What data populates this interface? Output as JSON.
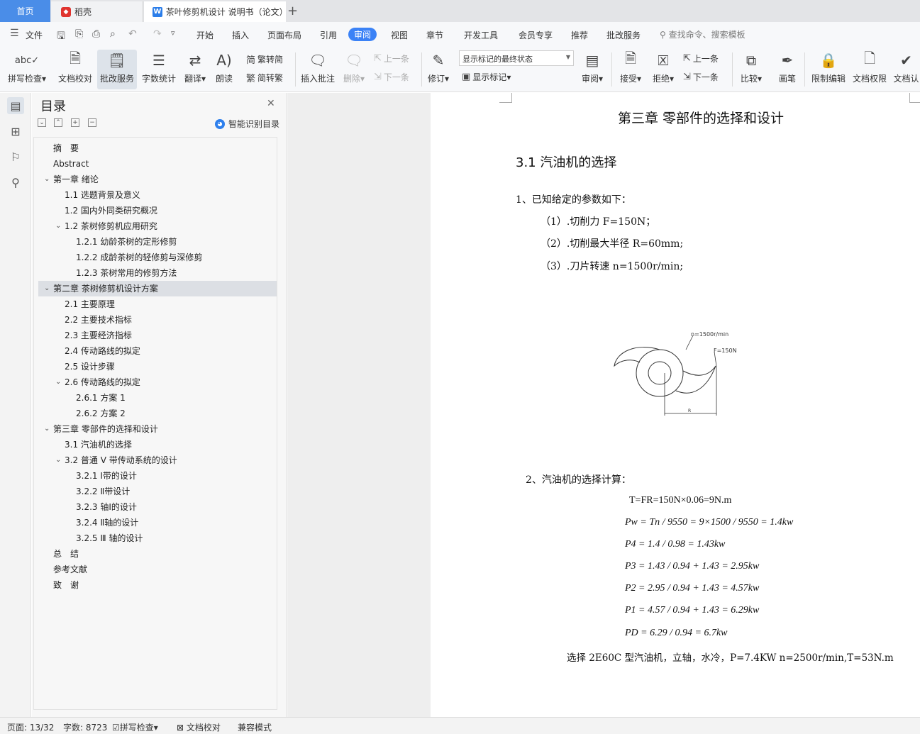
{
  "tabs": {
    "home": "首页",
    "daoke": "稻壳",
    "doc": "茶叶修剪机设计 说明书（论文）",
    "add": "+"
  },
  "menu": {
    "file": "文件",
    "items": [
      "开始",
      "插入",
      "页面布局",
      "引用",
      "审阅",
      "视图",
      "章节",
      "开发工具",
      "会员专享",
      "推荐",
      "批改服务"
    ],
    "active": "审阅",
    "search_placeholder": "查找命令、搜索模板"
  },
  "ribbon": {
    "spell": "拼写检查",
    "doc_check": "文档校对",
    "review_service": "批改服务",
    "word_count": "字数统计",
    "translate": "翻译",
    "read_aloud": "朗读",
    "trad": "繁转简",
    "simp": "简转繁",
    "insert_comment": "插入批注",
    "delete": "删除",
    "prev": "上一条",
    "next": "下一条",
    "revise": "修订",
    "markup_state": "显示标记的最终状态",
    "show_markup": "显示标记",
    "review": "审阅",
    "accept": "接受",
    "reject": "拒绝",
    "prev2": "上一条",
    "next2": "下一条",
    "compare": "比较",
    "pen": "画笔",
    "restrict": "限制编辑",
    "permission": "文档权限",
    "certify": "文档认"
  },
  "toc": {
    "title": "目录",
    "smart": "智能识别目录",
    "items": [
      {
        "text": "摘　要",
        "level": 1,
        "caret": ""
      },
      {
        "text": "Abstract",
        "level": 1,
        "caret": ""
      },
      {
        "text": "第一章  绪论",
        "level": 1,
        "caret": "v"
      },
      {
        "text": "1.1 选题背景及意义",
        "level": 2,
        "caret": ""
      },
      {
        "text": "1.2 国内外同类研究概况",
        "level": 2,
        "caret": ""
      },
      {
        "text": "1.2 茶树修剪机应用研究",
        "level": 2,
        "caret": "v"
      },
      {
        "text": "1.2.1 幼龄茶树的定形修剪",
        "level": 3,
        "caret": ""
      },
      {
        "text": "1.2.2 成龄茶树的轻修剪与深修剪",
        "level": 3,
        "caret": ""
      },
      {
        "text": "1.2.3 茶树常用的修剪方法",
        "level": 3,
        "caret": ""
      },
      {
        "text": "第二章  茶树修剪机设计方案",
        "level": 1,
        "caret": "v",
        "selected": true
      },
      {
        "text": "2.1 主要原理",
        "level": 2,
        "caret": ""
      },
      {
        "text": "2.2 主要技术指标",
        "level": 2,
        "caret": ""
      },
      {
        "text": "2.3 主要经济指标",
        "level": 2,
        "caret": ""
      },
      {
        "text": "2.4 传动路线的拟定",
        "level": 2,
        "caret": ""
      },
      {
        "text": "2.5 设计步骤",
        "level": 2,
        "caret": ""
      },
      {
        "text": "2.6 传动路线的拟定",
        "level": 2,
        "caret": "v"
      },
      {
        "text": "2.6.1 方案 1",
        "level": 3,
        "caret": ""
      },
      {
        "text": "2.6.2 方案 2",
        "level": 3,
        "caret": ""
      },
      {
        "text": "第三章  零部件的选择和设计",
        "level": 1,
        "caret": "v"
      },
      {
        "text": "3.1 汽油机的选择",
        "level": 2,
        "caret": ""
      },
      {
        "text": "3.2 普通 V 带传动系统的设计",
        "level": 2,
        "caret": "v"
      },
      {
        "text": "3.2.1 Ⅰ带的设计",
        "level": 3,
        "caret": ""
      },
      {
        "text": "3.2.2 Ⅱ带设计",
        "level": 3,
        "caret": ""
      },
      {
        "text": "3.2.3 轴Ⅰ的设计",
        "level": 3,
        "caret": ""
      },
      {
        "text": "3.2.4 Ⅱ轴的设计",
        "level": 3,
        "caret": ""
      },
      {
        "text": "3.2.5 Ⅲ  轴的设计",
        "level": 3,
        "caret": ""
      },
      {
        "text": "总　结",
        "level": 1,
        "caret": ""
      },
      {
        "text": "参考文献",
        "level": 1,
        "caret": ""
      },
      {
        "text": "致　谢",
        "level": 1,
        "caret": ""
      }
    ]
  },
  "page": {
    "chapter_title": "第三章  零部件的选择和设计",
    "section_title": "3.1 汽油机的选择",
    "p1": "1、已知给定的参数如下：",
    "p1_a": "（1）.切削力 F=150N；",
    "p1_b": "（2）.切削最大半径 R=60mm;",
    "p1_c": "（3）.刀片转速 n=1500r/min;",
    "fig_n": "n=1500r/min",
    "fig_f": "F=150N",
    "fig_r": "R",
    "p2": "2、汽油机的选择计算：",
    "eq1": "T=FR=150N×0.06=9N.m",
    "eq2": "Pw = Tn / 9550 = 9×1500 / 9550 = 1.4kw",
    "eq3": "P4 = 1.4 / 0.98 = 1.43kw",
    "eq4": "P3 = 1.43 / 0.94 + 1.43 =  2.95kw",
    "eq5": "P2 =  2.95 / 0.94 + 1.43 =  4.57kw",
    "eq6": "P1 =  4.57 / 0.94 + 1.43 =  6.29kw",
    "eq7": "PD =  6.29 / 0.94 =  6.7kw",
    "conclusion": "选择 2E60C 型汽油机，立轴，水冷，P=7.4KW n=2500r/min,T=53N.m"
  },
  "status": {
    "page": "页面: 13/32",
    "words": "字数: 8723",
    "spell": "拼写检查",
    "doc_check": "文档校对",
    "compat": "兼容模式"
  }
}
